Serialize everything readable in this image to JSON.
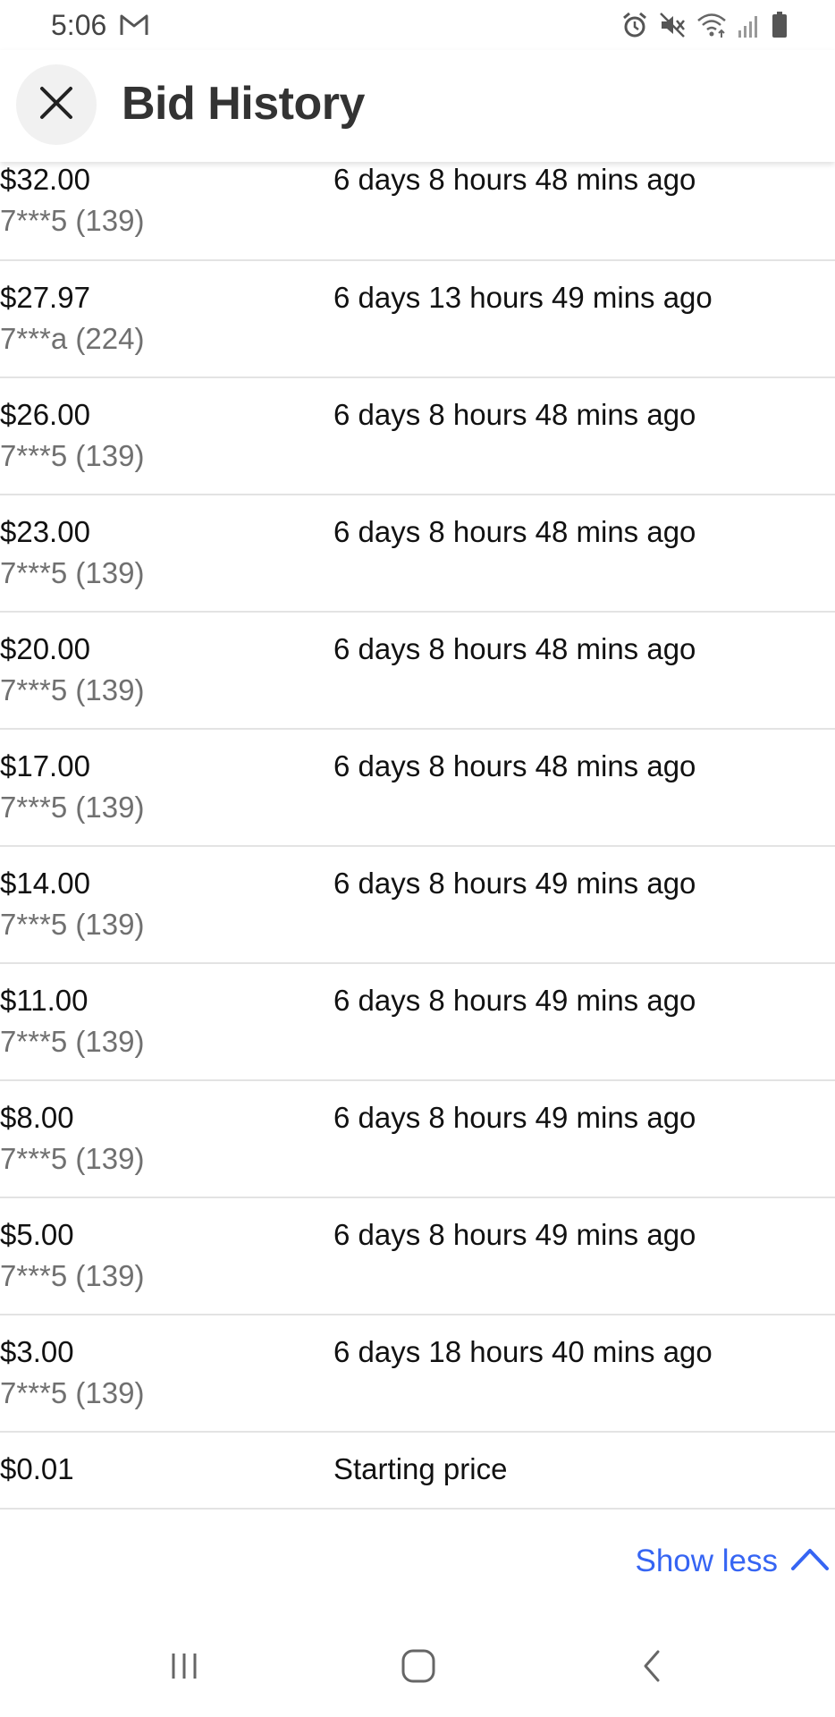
{
  "status_bar": {
    "time": "5:06",
    "icons": [
      "gmail-icon",
      "alarm-icon",
      "mute-icon",
      "wifi-icon",
      "signal-icon",
      "battery-icon"
    ]
  },
  "header": {
    "title": "Bid History",
    "close_icon": "close-icon"
  },
  "bids": [
    {
      "amount": "$32.00",
      "bidder": "7***5 (139)",
      "time": "6 days 8 hours 48 mins ago"
    },
    {
      "amount": "$27.97",
      "bidder": "7***a (224)",
      "time": "6 days 13 hours 49 mins ago"
    },
    {
      "amount": "$26.00",
      "bidder": "7***5 (139)",
      "time": "6 days 8 hours 48 mins ago"
    },
    {
      "amount": "$23.00",
      "bidder": "7***5 (139)",
      "time": "6 days 8 hours 48 mins ago"
    },
    {
      "amount": "$20.00",
      "bidder": "7***5 (139)",
      "time": "6 days 8 hours 48 mins ago"
    },
    {
      "amount": "$17.00",
      "bidder": "7***5 (139)",
      "time": "6 days 8 hours 48 mins ago"
    },
    {
      "amount": "$14.00",
      "bidder": "7***5 (139)",
      "time": "6 days 8 hours 49 mins ago"
    },
    {
      "amount": "$11.00",
      "bidder": "7***5 (139)",
      "time": "6 days 8 hours 49 mins ago"
    },
    {
      "amount": "$8.00",
      "bidder": "7***5 (139)",
      "time": "6 days 8 hours 49 mins ago"
    },
    {
      "amount": "$5.00",
      "bidder": "7***5 (139)",
      "time": "6 days 8 hours 49 mins ago"
    },
    {
      "amount": "$3.00",
      "bidder": "7***5 (139)",
      "time": "6 days 18 hours 40 mins ago"
    }
  ],
  "starting": {
    "amount": "$0.01",
    "label": "Starting price"
  },
  "footer": {
    "show_less_label": "Show less",
    "accent_color": "#3665f3"
  },
  "nav": {
    "icons": [
      "recent-apps-icon",
      "home-icon",
      "back-icon"
    ]
  }
}
